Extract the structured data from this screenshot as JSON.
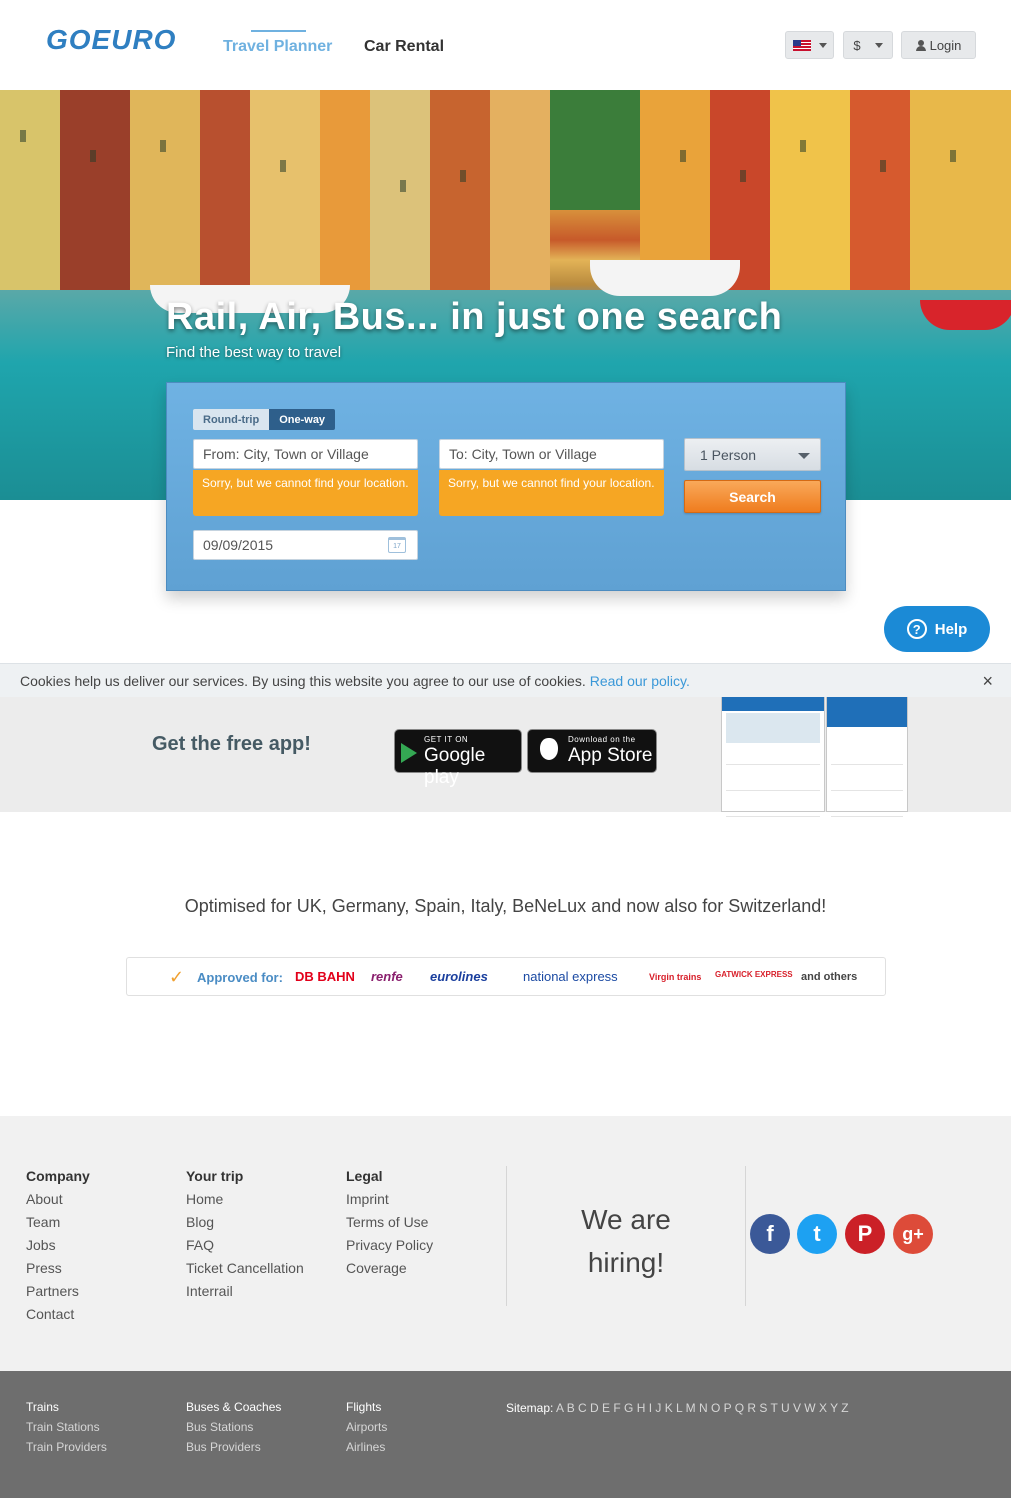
{
  "header": {
    "logo": "GOEURO",
    "nav_travel": "Travel Planner",
    "nav_car": "Car Rental",
    "currency": "$",
    "login": "Login"
  },
  "hero": {
    "title": "Rail, Air, Bus... in just one search",
    "subtitle": "Find the best way to travel"
  },
  "search": {
    "round_trip": "Round-trip",
    "one_way": "One-way",
    "from_placeholder": "From: City, Town or Village",
    "to_placeholder": "To: City, Town or Village",
    "error_msg": "Sorry, but we cannot find your location.",
    "person": "1 Person",
    "search_btn": "Search",
    "date": "09/09/2015",
    "cal_day": "17"
  },
  "help": {
    "label": "Help",
    "icon_glyph": "?"
  },
  "cookie": {
    "text": "Cookies help us deliver our services. By using this website you agree to our use of cookies.",
    "link": "Read our policy.",
    "close": "×"
  },
  "app": {
    "title": "Get the free app!",
    "gp_small": "GET IT ON",
    "gp_big": "Google play",
    "as_small": "Download on the",
    "as_big": "App Store"
  },
  "optimised": "Optimised for UK, Germany, Spain, Italy, BeNeLux and now also for Switzerland!",
  "approved": {
    "check": "✓",
    "label": "Approved for:",
    "partners": [
      {
        "name": "DB BAHN",
        "color": "#e2001a"
      },
      {
        "name": "renfe",
        "color": "#8a1f6e"
      },
      {
        "name": "eurolines",
        "color": "#1a3f9e"
      },
      {
        "name": "national express",
        "color": "#1b4aa3"
      },
      {
        "name": "Virgin trains",
        "color": "#d8202b"
      },
      {
        "name": "GATWICK EXPRESS",
        "color": "#d8202b"
      }
    ],
    "others": "and others"
  },
  "footer": {
    "company": {
      "title": "Company",
      "items": [
        "About",
        "Team",
        "Jobs",
        "Press",
        "Partners",
        "Contact"
      ]
    },
    "trip": {
      "title": "Your trip",
      "items": [
        "Home",
        "Blog",
        "FAQ",
        "Ticket Cancellation",
        "Interrail"
      ]
    },
    "legal": {
      "title": "Legal",
      "items": [
        "Imprint",
        "Terms of Use",
        "Privacy Policy",
        "Coverage"
      ]
    },
    "hiring_1": "We are",
    "hiring_2": "hiring!",
    "social": [
      {
        "name": "facebook",
        "glyph": "f",
        "color": "#3b5998"
      },
      {
        "name": "twitter",
        "glyph": "t",
        "color": "#1da1f2"
      },
      {
        "name": "pinterest",
        "glyph": "P",
        "color": "#cb2027"
      },
      {
        "name": "google-plus",
        "glyph": "g+",
        "color": "#dd4b39"
      }
    ]
  },
  "bottom": {
    "trains": {
      "title": "Trains",
      "items": [
        "Train Stations",
        "Train Providers"
      ]
    },
    "buses": {
      "title": "Buses & Coaches",
      "items": [
        "Bus Stations",
        "Bus Providers"
      ]
    },
    "flights": {
      "title": "Flights",
      "items": [
        "Airports",
        "Airlines"
      ]
    },
    "sitemap_label": "Sitemap:",
    "sitemap_letters": "A B C D E F G H I J K L M N O P Q R S T U V W X Y Z"
  }
}
